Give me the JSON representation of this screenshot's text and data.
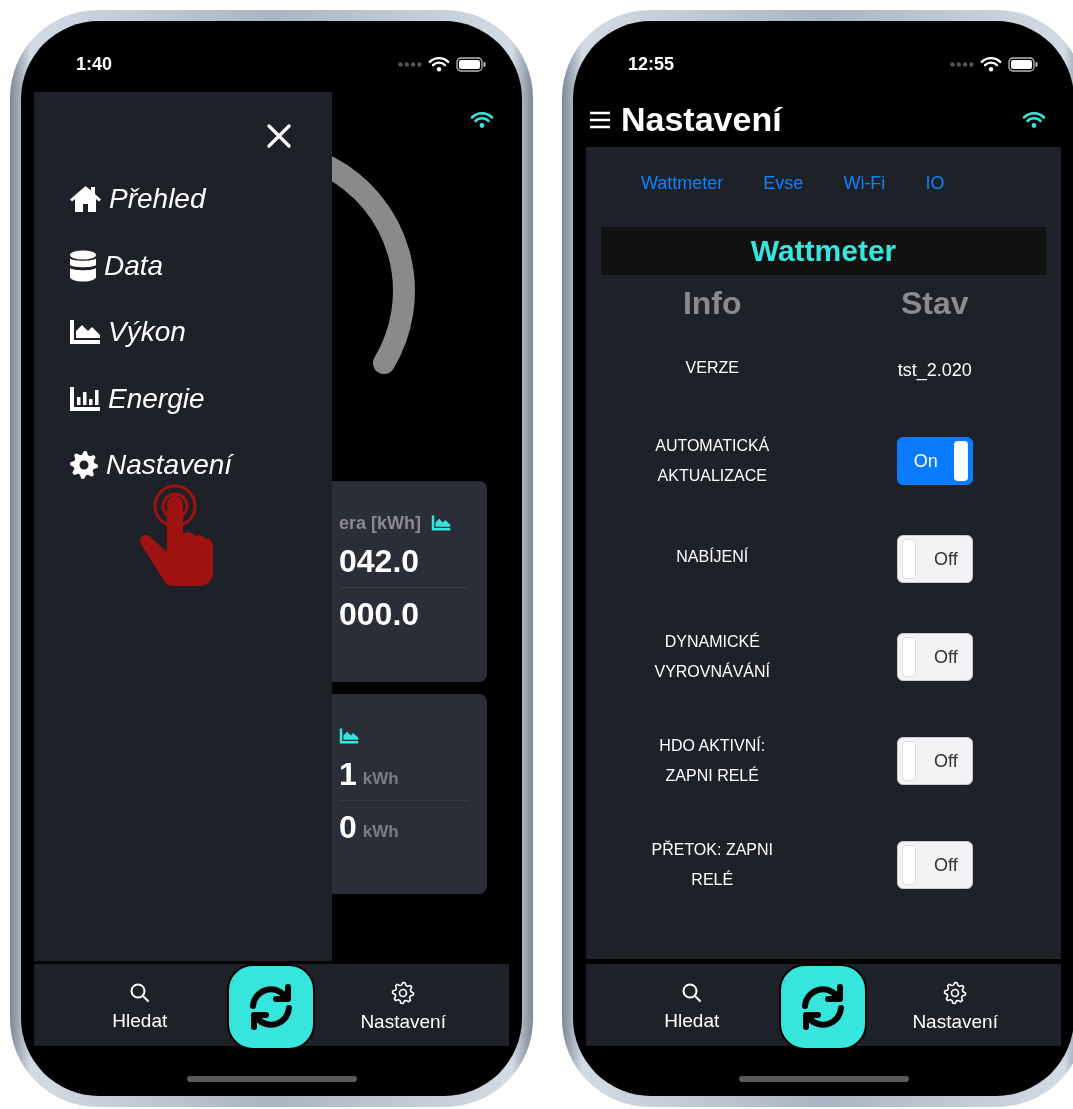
{
  "left_phone": {
    "status_bar": {
      "time": "1:40"
    },
    "dashboard": {
      "cards": [
        {
          "title": "era [kWh]",
          "rows": [
            {
              "value": "042.0"
            },
            {
              "value": "000.0"
            }
          ]
        },
        {
          "rows": [
            {
              "value": "1",
              "unit": "kWh"
            },
            {
              "value": "0",
              "unit": "kWh"
            }
          ]
        }
      ]
    },
    "drawer": {
      "items": [
        {
          "label": "Přehled"
        },
        {
          "label": "Data"
        },
        {
          "label": "Výkon"
        },
        {
          "label": "Energie"
        },
        {
          "label": "Nastavení"
        }
      ]
    },
    "tab_bar": {
      "items": [
        {
          "label": "Hledat"
        },
        {
          "label": "Nastavení"
        }
      ]
    }
  },
  "right_phone": {
    "status_bar": {
      "time": "12:55"
    },
    "header": {
      "title": "Nastavení"
    },
    "tabs": [
      {
        "label": "Wattmeter"
      },
      {
        "label": "Evse"
      },
      {
        "label": "Wi-Fi"
      },
      {
        "label": "IO"
      }
    ],
    "section_title": "Wattmeter",
    "columns": [
      "Info",
      "Stav"
    ],
    "rows": [
      {
        "label": "VERZE",
        "kind": "text",
        "value": "tst_2.020"
      },
      {
        "label": "AUTOMATICKÁ AKTUALIZACE",
        "kind": "toggle",
        "on": true,
        "text": "On"
      },
      {
        "label": "NABÍJENÍ",
        "kind": "toggle",
        "on": false,
        "text": "Off"
      },
      {
        "label": "DYNAMICKÉ VYROVNÁVÁNÍ",
        "kind": "toggle",
        "on": false,
        "text": "Off"
      },
      {
        "label": "HDO AKTIVNÍ: ZAPNI RELÉ",
        "kind": "toggle",
        "on": false,
        "text": "Off"
      },
      {
        "label": "PŘETOK: ZAPNI RELÉ",
        "kind": "toggle",
        "on": false,
        "text": "Off"
      }
    ],
    "tab_bar": {
      "items": [
        {
          "label": "Hledat"
        },
        {
          "label": "Nastavení"
        }
      ]
    }
  }
}
